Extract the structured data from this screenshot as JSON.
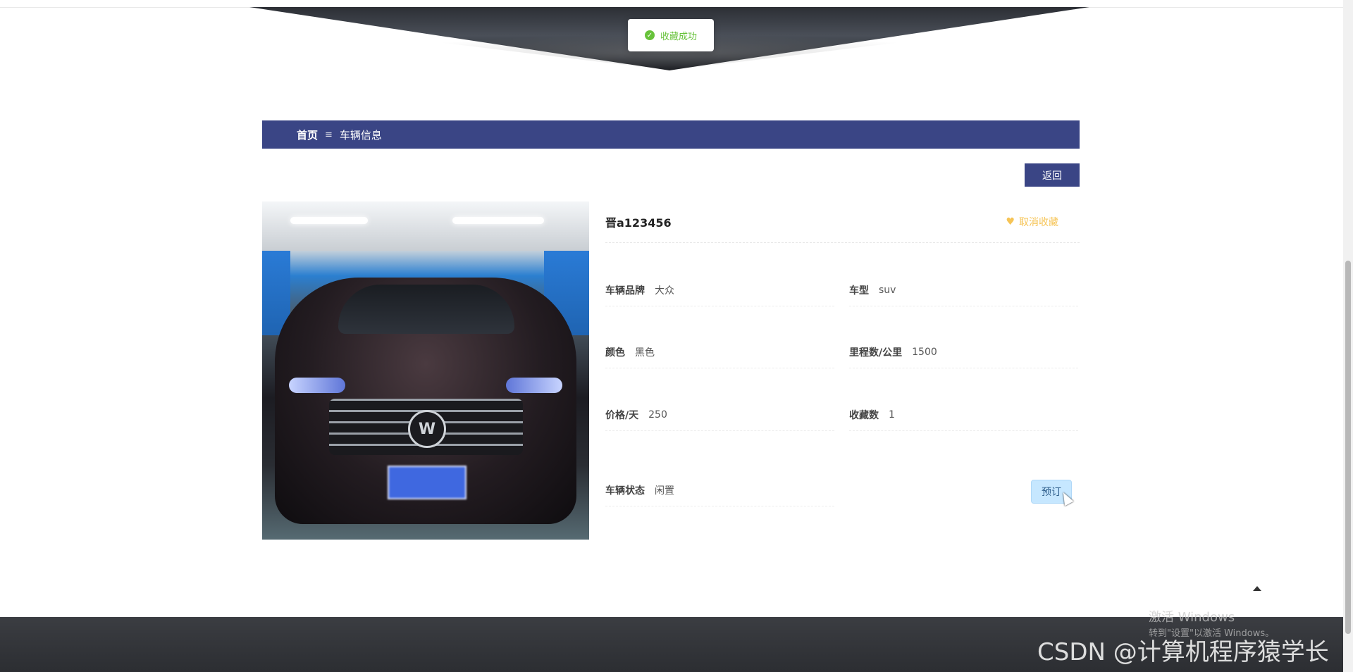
{
  "toast": {
    "message": "收藏成功"
  },
  "breadcrumb": {
    "home": "首页",
    "separator": "≡",
    "current": "车辆信息"
  },
  "actions": {
    "back_label": "返回",
    "reserve_label": "预订"
  },
  "vehicle": {
    "plate": "晋a123456",
    "favorite_label": "取消收藏",
    "fields": {
      "brand": {
        "label": "车辆品牌",
        "value": "大众"
      },
      "model": {
        "label": "车型",
        "value": "suv"
      },
      "color": {
        "label": "颜色",
        "value": "黑色"
      },
      "mileage": {
        "label": "里程数/公里",
        "value": "1500"
      },
      "price": {
        "label": "价格/天",
        "value": "250"
      },
      "favorites": {
        "label": "收藏数",
        "value": "1"
      },
      "status": {
        "label": "车辆状态",
        "value": "闲置"
      }
    }
  },
  "os_watermark": {
    "line1": "激活 Windows",
    "line2": "转到\"设置\"以激活 Windows。"
  },
  "csdn_watermark": "CSDN @计算机程序猿学长",
  "colors": {
    "primary": "#3a4585",
    "success": "#67c23a",
    "favorite": "#f6c456",
    "reserve": "#c6e7ff"
  }
}
